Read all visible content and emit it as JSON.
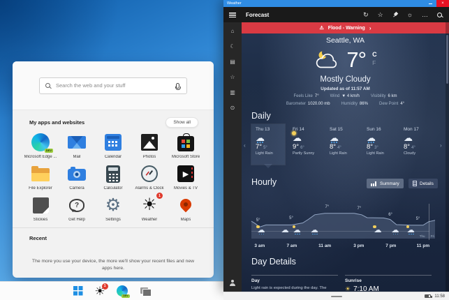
{
  "start_menu": {
    "search_placeholder": "Search the web and your stuff",
    "apps_title": "My apps and websites",
    "show_all": "Show all",
    "apps": [
      {
        "name": "Microsoft Edge ...",
        "icon": "edge",
        "badge": "DEV"
      },
      {
        "name": "Mail",
        "icon": "mail"
      },
      {
        "name": "Calendar",
        "icon": "calendar"
      },
      {
        "name": "Photos",
        "icon": "photos"
      },
      {
        "name": "Microsoft Store",
        "icon": "store"
      },
      {
        "name": "File Explorer",
        "icon": "explorer"
      },
      {
        "name": "Camera",
        "icon": "camera"
      },
      {
        "name": "Calculator",
        "icon": "calculator"
      },
      {
        "name": "Alarms & Clock",
        "icon": "clock"
      },
      {
        "name": "Movies & TV",
        "icon": "movies"
      },
      {
        "name": "Stickies",
        "icon": "stickies"
      },
      {
        "name": "Get Help",
        "icon": "gethelp"
      },
      {
        "name": "Settings",
        "icon": "settings"
      },
      {
        "name": "Weather",
        "icon": "weather",
        "badge": "1"
      },
      {
        "name": "Maps",
        "icon": "maps"
      }
    ],
    "recent_title": "Recent",
    "recent_empty": "The more you use your device, the more we'll show your recent files and new apps here."
  },
  "taskbar": {
    "weather_badge": "1",
    "edge_badge": "DEV"
  },
  "system_tray": {
    "time": "11:58"
  },
  "weather_app": {
    "window_title": "Weather",
    "toolbar_title": "Forecast",
    "warning": "Flood - Warning",
    "location": "Seattle, WA",
    "temperature": "7°",
    "unit_c": "C",
    "unit_f": "F",
    "condition": "Mostly Cloudy",
    "updated": "Updated as of 11:57 AM",
    "details": [
      {
        "label": "Feels Like",
        "value": "7°"
      },
      {
        "label": "Wind",
        "value": "▼ 4 km/h"
      },
      {
        "label": "Visibility",
        "value": "6 km"
      },
      {
        "label": "Barometer",
        "value": "1020.00 mb"
      },
      {
        "label": "Humidity",
        "value": "86%"
      },
      {
        "label": "Dew Point",
        "value": "4°"
      }
    ],
    "daily_title": "Daily",
    "daily": [
      {
        "day": "Thu 13",
        "high": "7°",
        "low": "5°",
        "condition": "Light Rain",
        "icon": "cloud-rain",
        "selected": true
      },
      {
        "day": "Fri 14",
        "high": "9°",
        "low": "6°",
        "condition": "Partly Sunny",
        "icon": "cloud-sun",
        "selected": false
      },
      {
        "day": "Sat 15",
        "high": "8°",
        "low": "4°",
        "condition": "Light Rain",
        "icon": "cloud-rain",
        "selected": false
      },
      {
        "day": "Sun 16",
        "high": "8°",
        "low": "3°",
        "condition": "Light Rain",
        "icon": "cloud-rain",
        "selected": false
      },
      {
        "day": "Mon 17",
        "high": "8°",
        "low": "4°",
        "condition": "Cloudy",
        "icon": "cloud",
        "selected": false
      }
    ],
    "hourly_title": "Hourly",
    "summary_label": "Summary",
    "details_label": "Details",
    "day_details_title": "Day Details",
    "day_label": "Day",
    "day_text": "Light rain is expected during the day. The",
    "sunrise_label": "Sunrise",
    "sunrise_time": "7:10 AM"
  },
  "chart_data": {
    "type": "area",
    "title": "Hourly temperature",
    "unit": "°C",
    "y_range": [
      3,
      9
    ],
    "points": [
      [
        0,
        6
      ],
      [
        0.02,
        5.6
      ],
      [
        0.045,
        5
      ],
      [
        0.08,
        5.35
      ],
      [
        0.22,
        5.35
      ],
      [
        0.28,
        5.7
      ],
      [
        0.31,
        6.3
      ],
      [
        0.345,
        7.1
      ],
      [
        0.4,
        7.35
      ],
      [
        0.56,
        7.35
      ],
      [
        0.6,
        7.1
      ],
      [
        0.63,
        6.6
      ],
      [
        0.72,
        6.55
      ],
      [
        0.755,
        6.3
      ],
      [
        0.79,
        5.4
      ],
      [
        0.87,
        5.3
      ],
      [
        0.935,
        5.3
      ],
      [
        0.965,
        5.9
      ],
      [
        1,
        6.15
      ]
    ],
    "temp_labels": [
      {
        "x": 0.045,
        "label": "5°"
      },
      {
        "x": 0.225,
        "label": "5°"
      },
      {
        "x": 0.42,
        "label": "7°"
      },
      {
        "x": 0.595,
        "label": "7°"
      },
      {
        "x": 0.765,
        "label": "6°"
      },
      {
        "x": 0.915,
        "label": "5°"
      }
    ],
    "icons": [
      {
        "x": 0.055,
        "type": "cloud-rain-moon"
      },
      {
        "x": 0.185,
        "type": "cloud"
      },
      {
        "x": 0.25,
        "type": "cloud-rain-sun"
      },
      {
        "x": 0.345,
        "type": "cloud-rain"
      },
      {
        "x": 0.69,
        "type": "cloud-moon"
      },
      {
        "x": 0.785,
        "type": "cloud-rain"
      },
      {
        "x": 0.87,
        "type": "cloud-rain-moon"
      }
    ],
    "x_ticks": [
      {
        "x": 0.045,
        "label": "3 am"
      },
      {
        "x": 0.22,
        "label": "7 am"
      },
      {
        "x": 0.4,
        "label": "11 am"
      },
      {
        "x": 0.585,
        "label": "3 pm"
      },
      {
        "x": 0.76,
        "label": "7 pm"
      },
      {
        "x": 0.935,
        "label": "11 pm"
      }
    ],
    "day_divider": {
      "x": 0.965,
      "left": "Thu",
      "right": "Fri"
    }
  }
}
